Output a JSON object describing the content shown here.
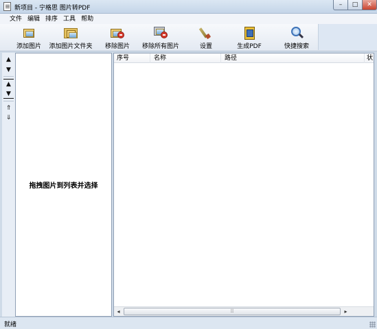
{
  "window": {
    "title": "新项目 - 宁格思 图片转PDF",
    "minimize_glyph": "–",
    "maximize_glyph": "□",
    "close_glyph": "✕"
  },
  "menu": [
    "文件",
    "编辑",
    "排序",
    "工具",
    "帮助"
  ],
  "toolbar": {
    "buttons": [
      {
        "label": "添加图片",
        "icon": "add-image-icon"
      },
      {
        "label": "添加图片文件夹",
        "icon": "add-folder-icon"
      },
      {
        "label": "移除图片",
        "icon": "remove-image-icon"
      },
      {
        "label": "移除所有图片",
        "icon": "remove-all-images-icon"
      },
      {
        "label": "设置",
        "icon": "settings-icon"
      },
      {
        "label": "生成PDF",
        "icon": "generate-pdf-icon"
      },
      {
        "label": "快捷搜索",
        "icon": "search-icon"
      }
    ]
  },
  "side_tools": {
    "up": "▲",
    "down": "▼",
    "top": "▲",
    "bottom": "▼",
    "up_fast": "⇑",
    "down_fast": "⇓"
  },
  "left_pane": {
    "hint": "拖拽图片到列表并选择"
  },
  "list": {
    "columns": [
      "序号",
      "名称",
      "路径",
      "状"
    ],
    "rows": []
  },
  "scrollbar": {
    "left_arrow": "◂",
    "right_arrow": "▸",
    "grip": "⦙⦙⦙"
  },
  "status": {
    "text": "就绪"
  }
}
